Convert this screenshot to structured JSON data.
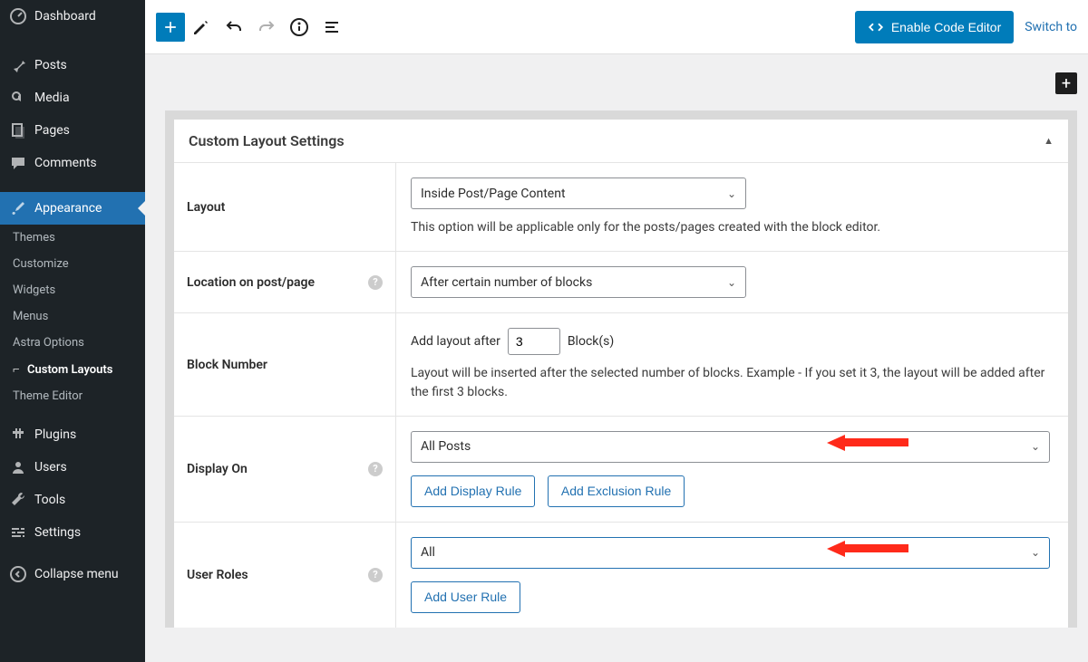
{
  "sidebar": {
    "dashboard": "Dashboard",
    "posts": "Posts",
    "media": "Media",
    "pages": "Pages",
    "comments": "Comments",
    "appearance": "Appearance",
    "appearance_sub": {
      "themes": "Themes",
      "customize": "Customize",
      "widgets": "Widgets",
      "menus": "Menus",
      "astra_options": "Astra Options",
      "custom_layouts": "Custom Layouts",
      "theme_editor": "Theme Editor"
    },
    "plugins": "Plugins",
    "users": "Users",
    "tools": "Tools",
    "settings": "Settings",
    "collapse": "Collapse menu"
  },
  "topbar": {
    "code_editor_label": "Enable Code Editor",
    "switch_to": "Switch to"
  },
  "panel": {
    "title": "Custom Layout Settings",
    "layout_label": "Layout",
    "layout_select": "Inside Post/Page Content",
    "layout_help": "This option will be applicable only for the posts/pages created with the block editor.",
    "location_label": "Location on post/page",
    "location_select": "After certain number of blocks",
    "block_number_label": "Block Number",
    "add_layout_after": "Add layout after",
    "block_number_value": "3",
    "block_s": "Block(s)",
    "block_number_help": "Layout will be inserted after the selected number of blocks. Example - If you set it 3, the layout will be added after the first 3 blocks.",
    "display_on_label": "Display On",
    "display_on_select": "All Posts",
    "add_display_rule": "Add Display Rule",
    "add_exclusion_rule": "Add Exclusion Rule",
    "user_roles_label": "User Roles",
    "user_roles_select": "All",
    "add_user_rule": "Add User Rule"
  }
}
